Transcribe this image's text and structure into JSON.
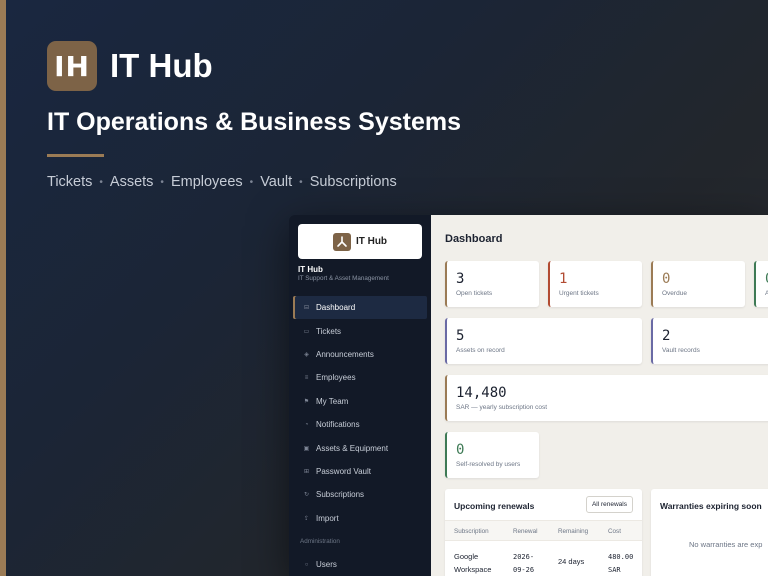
{
  "brand": {
    "logo_text": "IH",
    "name": "IT Hub"
  },
  "headline": "IT Operations & Business Systems",
  "features": [
    "Tickets",
    "Assets",
    "Employees",
    "Vault",
    "Subscriptions"
  ],
  "colors": {
    "accent": "#9b7b55",
    "logo_bg": "#7d6347",
    "sidebar_bg": "#121927",
    "main_bg": "#f1efea",
    "urgent": "#b24b32",
    "success": "#3e7a55",
    "info": "#6a6aa5"
  },
  "app": {
    "sidebar": {
      "logo_text": "IT Hub",
      "title": "IT Hub",
      "subtitle": "IT Support & Asset Management",
      "nav": [
        {
          "label": "Dashboard",
          "icon": "grid-icon",
          "glyph": "⊟",
          "active": true
        },
        {
          "label": "Tickets",
          "icon": "ticket-icon",
          "glyph": "▭"
        },
        {
          "label": "Announcements",
          "icon": "diamond-icon",
          "glyph": "◈"
        },
        {
          "label": "Employees",
          "icon": "list-icon",
          "glyph": "≡"
        },
        {
          "label": "My Team",
          "icon": "flag-icon",
          "glyph": "⚑"
        },
        {
          "label": "Notifications",
          "icon": "bell-icon",
          "glyph": "◔"
        },
        {
          "label": "Assets & Equipment",
          "icon": "box-icon",
          "glyph": "▣"
        },
        {
          "label": "Password Vault",
          "icon": "vault-icon",
          "glyph": "⊞"
        },
        {
          "label": "Subscriptions",
          "icon": "refresh-icon",
          "glyph": "↻"
        },
        {
          "label": "Import",
          "icon": "upload-icon",
          "glyph": "⇪"
        }
      ],
      "section_label": "Administration",
      "admin_nav": [
        {
          "label": "Users",
          "icon": "user-icon",
          "glyph": "○"
        }
      ]
    },
    "main": {
      "title": "Dashboard",
      "stats": [
        {
          "value": "3",
          "label": "Open tickets"
        },
        {
          "value": "1",
          "label": "Urgent tickets"
        },
        {
          "value": "0",
          "label": "Overdue"
        },
        {
          "value": "0",
          "label": "A"
        }
      ],
      "stats2": [
        {
          "value": "5",
          "label": "Assets on record"
        },
        {
          "value": "2",
          "label": "Vault records"
        }
      ],
      "cost": {
        "value": "14,480",
        "label": "SAR — yearly subscription cost"
      },
      "resolved": {
        "value": "0",
        "label": "Self-resolved by users"
      },
      "renewals": {
        "title": "Upcoming renewals",
        "button": "All renewals",
        "columns": [
          "Subscription",
          "Renewal",
          "Remaining",
          "Cost"
        ],
        "rows": [
          {
            "subscription": "Google\nWorkspace",
            "renewal": "2026-\n09-26",
            "remaining": "24 days",
            "cost": "480.00\nSAR"
          }
        ]
      },
      "warranties": {
        "title": "Warranties expiring soon",
        "empty": "No warranties are exp"
      }
    }
  }
}
